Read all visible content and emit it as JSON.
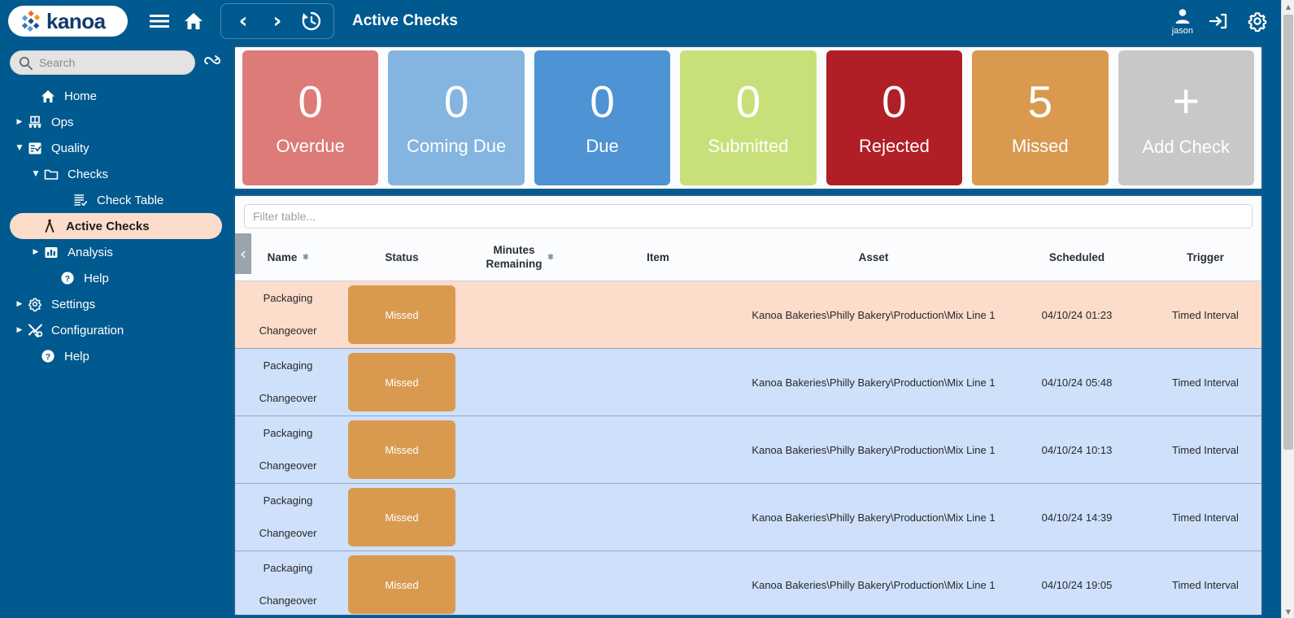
{
  "topbar": {
    "logo_text": "kanoa",
    "menu_icon": "hamburger-icon",
    "home_icon": "home-icon",
    "back_icon": "chevron-left-icon",
    "forward_icon": "chevron-right-icon",
    "history_icon": "history-clock-icon",
    "page_title": "Active Checks",
    "user_name": "jason",
    "logout_icon": "logout-icon",
    "settings_icon": "gear-icon"
  },
  "sidebar": {
    "search_placeholder": "Search",
    "search_value": "",
    "search_icon": "search-icon",
    "loop_icon": "loop-arrow-icon",
    "items": [
      {
        "label": "Home",
        "icon": "home-icon",
        "indent": "lvl0b",
        "caret": "",
        "active": false
      },
      {
        "label": "Ops",
        "icon": "conveyor-icon",
        "indent": "lvl0",
        "caret": "▶",
        "active": false
      },
      {
        "label": "Quality",
        "icon": "clipboard-icon",
        "indent": "lvl0",
        "caret": "▼",
        "active": false
      },
      {
        "label": "Checks",
        "icon": "folder-icon",
        "indent": "lvl1",
        "caret": "▼",
        "active": false
      },
      {
        "label": "Check Table",
        "icon": "table-list-icon",
        "indent": "lvl2b",
        "caret": "",
        "active": false
      },
      {
        "label": "Active Checks",
        "icon": "caliper-icon",
        "indent": "lvl2c",
        "caret": "",
        "active": true
      },
      {
        "label": "Analysis",
        "icon": "bar-chart-icon",
        "indent": "lvl1",
        "caret": "▶",
        "active": false
      },
      {
        "label": "Help",
        "icon": "question-icon",
        "indent": "lvl2",
        "caret": "",
        "active": false
      },
      {
        "label": "Settings",
        "icon": "gear-icon",
        "indent": "lvl0",
        "caret": "▶",
        "active": false
      },
      {
        "label": "Configuration",
        "icon": "tools-icon",
        "indent": "lvl0",
        "caret": "▶",
        "active": false
      },
      {
        "label": "Help",
        "icon": "question-icon",
        "indent": "lvl0b",
        "caret": "",
        "active": false
      }
    ]
  },
  "kpis": [
    {
      "value": "0",
      "label": "Overdue",
      "color": "#dd7b78"
    },
    {
      "value": "0",
      "label": "Coming Due",
      "color": "#84b5e0"
    },
    {
      "value": "0",
      "label": "Due",
      "color": "#4e93d4"
    },
    {
      "value": "0",
      "label": "Submitted",
      "color": "#c8e07a"
    },
    {
      "value": "0",
      "label": "Rejected",
      "color": "#b01f26"
    },
    {
      "value": "5",
      "label": "Missed",
      "color": "#d99a50"
    },
    {
      "value": "+",
      "label": "Add Check",
      "color": "#c8c8c8"
    }
  ],
  "table": {
    "filter_placeholder": "Filter table...",
    "filter_value": "",
    "collapse_icon": "chevron-left-icon",
    "columns": [
      {
        "label": "Name",
        "sortable": true
      },
      {
        "label": "Status",
        "sortable": false
      },
      {
        "label": "Minutes\nRemaining",
        "sortable": true
      },
      {
        "label": "Item",
        "sortable": false
      },
      {
        "label": "Asset",
        "sortable": false
      },
      {
        "label": "Scheduled",
        "sortable": false
      },
      {
        "label": "Trigger",
        "sortable": false
      }
    ],
    "column_labels": {
      "name": "Name",
      "status": "Status",
      "minutes_remaining_line1": "Minutes",
      "minutes_remaining_line2": "Remaining",
      "item": "Item",
      "asset": "Asset",
      "scheduled": "Scheduled",
      "trigger": "Trigger"
    },
    "rows": [
      {
        "name_line1": "Packaging",
        "name_line2": "Changeover",
        "status": "Missed",
        "status_color": "#d99a50",
        "minutes_remaining": "",
        "item": "",
        "asset": "Kanoa Bakeries\\Philly Bakery\\Production\\Mix Line 1",
        "scheduled": "04/10/24 01:23",
        "trigger": "Timed Interval",
        "row_style": "row-peach"
      },
      {
        "name_line1": "Packaging",
        "name_line2": "Changeover",
        "status": "Missed",
        "status_color": "#d99a50",
        "minutes_remaining": "",
        "item": "",
        "asset": "Kanoa Bakeries\\Philly Bakery\\Production\\Mix Line 1",
        "scheduled": "04/10/24 05:48",
        "trigger": "Timed Interval",
        "row_style": "row-blue"
      },
      {
        "name_line1": "Packaging",
        "name_line2": "Changeover",
        "status": "Missed",
        "status_color": "#d99a50",
        "minutes_remaining": "",
        "item": "",
        "asset": "Kanoa Bakeries\\Philly Bakery\\Production\\Mix Line 1",
        "scheduled": "04/10/24 10:13",
        "trigger": "Timed Interval",
        "row_style": "row-blue"
      },
      {
        "name_line1": "Packaging",
        "name_line2": "Changeover",
        "status": "Missed",
        "status_color": "#d99a50",
        "minutes_remaining": "",
        "item": "",
        "asset": "Kanoa Bakeries\\Philly Bakery\\Production\\Mix Line 1",
        "scheduled": "04/10/24 14:39",
        "trigger": "Timed Interval",
        "row_style": "row-blue"
      },
      {
        "name_line1": "Packaging",
        "name_line2": "Changeover",
        "status": "Missed",
        "status_color": "#d99a50",
        "minutes_remaining": "",
        "item": "",
        "asset": "Kanoa Bakeries\\Philly Bakery\\Production\\Mix Line 1",
        "scheduled": "04/10/24 19:05",
        "trigger": "Timed Interval",
        "row_style": "row-blue"
      }
    ]
  },
  "scrollbar": {
    "up_arrow": "▲",
    "down_arrow": "▼"
  },
  "theme": {
    "brand_blue": "#00598f",
    "panel_border": "#1b5e8a",
    "highlight_peach": "#fcdcca",
    "row_blue": "#cfe0fa"
  }
}
